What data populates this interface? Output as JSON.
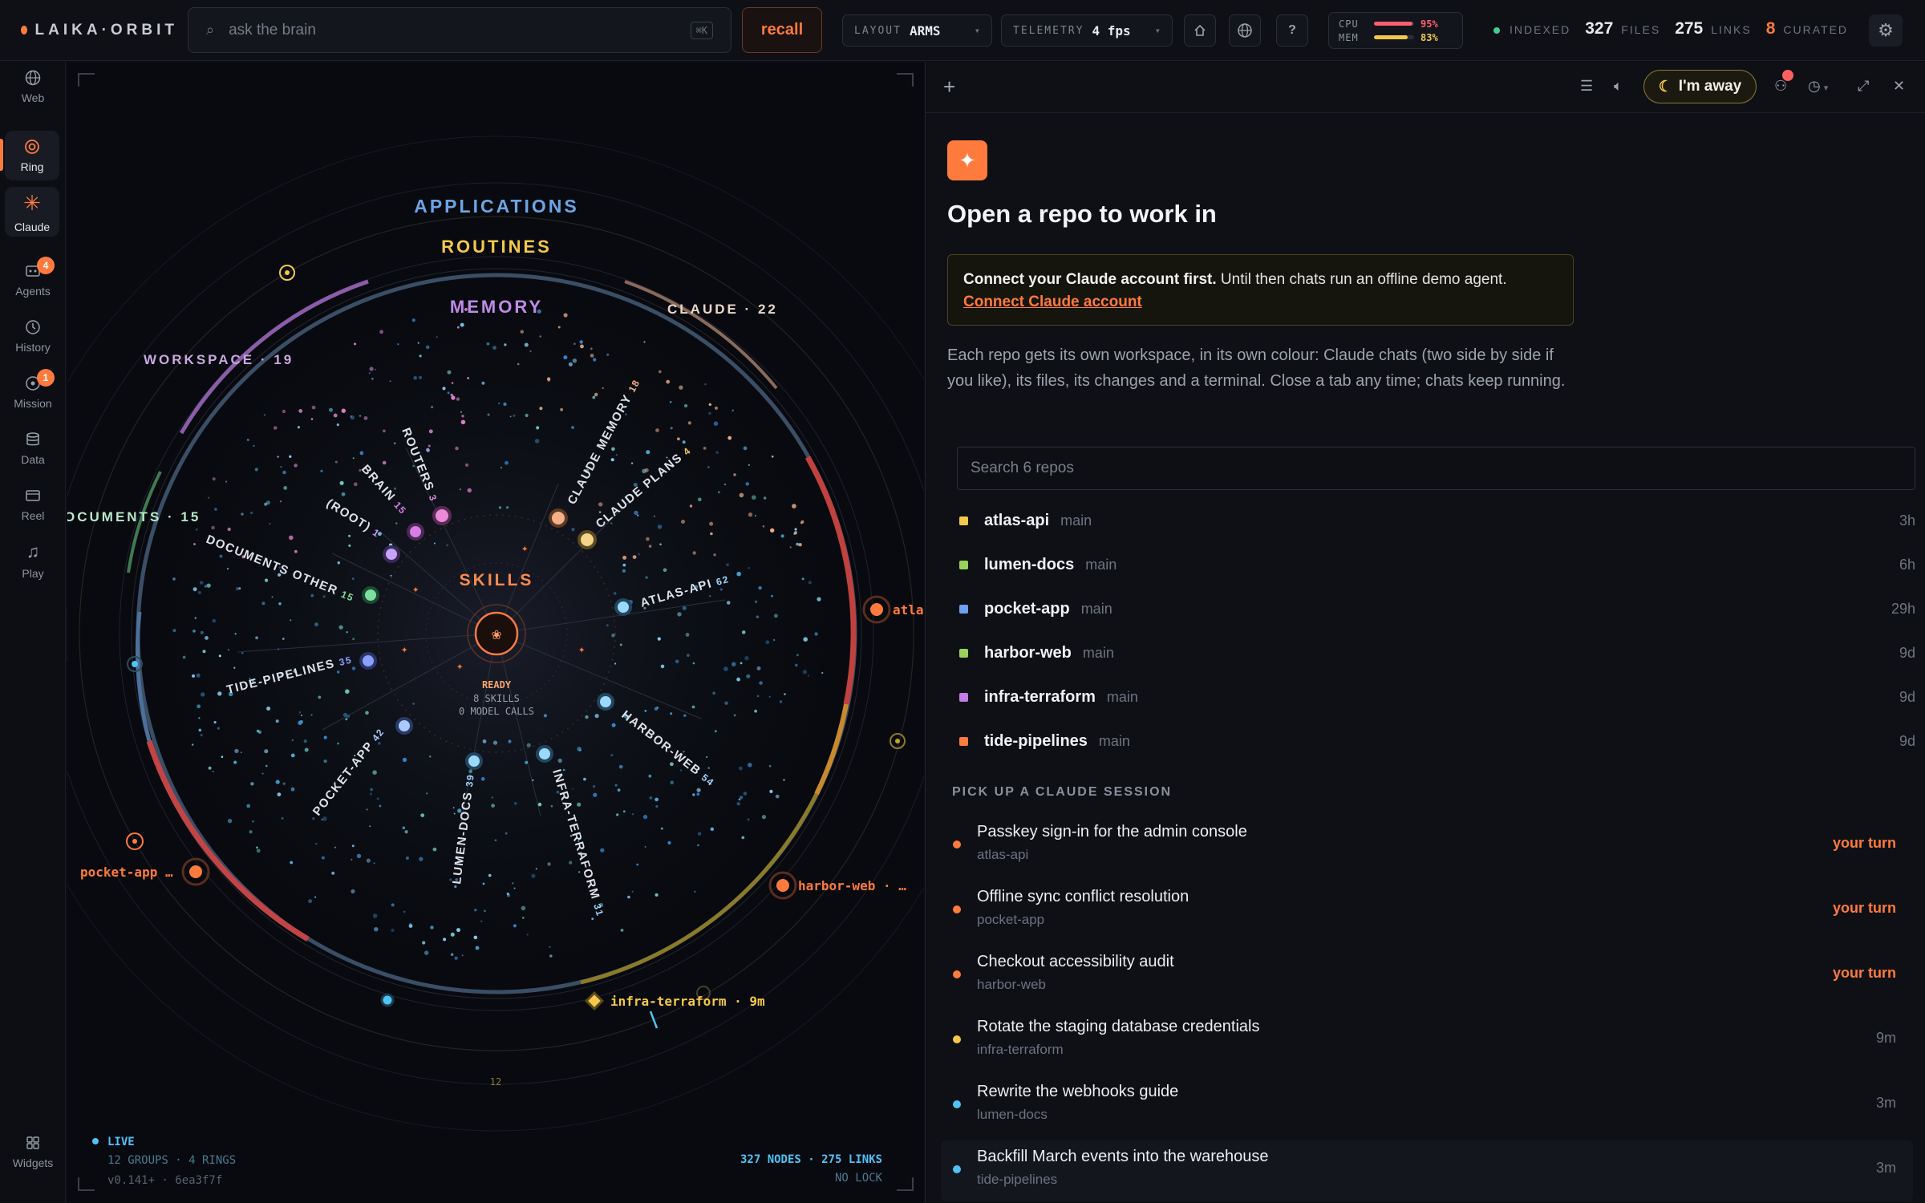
{
  "app": {
    "name": "LAIKA·ORBIT"
  },
  "search": {
    "placeholder": "ask the brain",
    "shortcut": "⌘K"
  },
  "recall_label": "recall",
  "layout": {
    "label": "LAYOUT",
    "value": "ARMS"
  },
  "telemetry": {
    "label": "TELEMETRY",
    "value": "4 fps"
  },
  "toolbar_icons": [
    "home-icon",
    "globe-icon",
    "help-icon"
  ],
  "help_glyph": "?",
  "resources": {
    "cpu_label": "CPU",
    "cpu_value": "95%",
    "cpu_fraction": 0.95,
    "mem_label": "MEM",
    "mem_value": "83%",
    "mem_fraction": 0.83
  },
  "index_stats": {
    "status": "INDEXED",
    "files": "327",
    "files_label": "FILES",
    "links": "275",
    "links_label": "LINKS",
    "curated": "8",
    "curated_label": "CURATED"
  },
  "rail": [
    {
      "label": "Web",
      "icon": "globe-icon"
    },
    {
      "label": "Ring",
      "icon": "ring-icon"
    },
    {
      "label": "Claude",
      "icon": "asterisk-icon"
    },
    {
      "label": "Agents",
      "icon": "agents-icon",
      "badge": "4"
    },
    {
      "label": "History",
      "icon": "history-icon"
    },
    {
      "label": "Mission",
      "icon": "mission-icon",
      "badge": "1"
    },
    {
      "label": "Data",
      "icon": "database-icon"
    },
    {
      "label": "Reel",
      "icon": "reel-icon"
    },
    {
      "label": "Play",
      "icon": "music-icon"
    },
    {
      "label": "Widgets",
      "icon": "grid-icon"
    }
  ],
  "ring": {
    "layers": [
      "APPLICATIONS",
      "ROUTINES",
      "MEMORY"
    ],
    "outer_labels": [
      "WORKSPACE · 19",
      "CLAUDE · 22",
      "OCUMENTS · 15"
    ],
    "core": {
      "title": "SKILLS",
      "status": "READY",
      "skills": "8 SKILLS",
      "calls": "0 MODEL CALLS"
    },
    "arms": [
      {
        "name": "ROUTERS",
        "count": "3"
      },
      {
        "name": "BRAIN",
        "count": "15"
      },
      {
        "name": "(ROOT)",
        "count": "1"
      },
      {
        "name": "DOCUMENTS OTHER",
        "count": "15"
      },
      {
        "name": "TIDE-PIPELINES",
        "count": "35"
      },
      {
        "name": "POCKET-APP",
        "count": "42"
      },
      {
        "name": "LUMEN-DOCS",
        "count": "39"
      },
      {
        "name": "INFRA-TERRAFORM",
        "count": "31"
      },
      {
        "name": "HARBOR-WEB",
        "count": "54"
      },
      {
        "name": "ATLAS-API",
        "count": "62"
      },
      {
        "name": "CLAUDE PLANS",
        "count": "4"
      },
      {
        "name": "CLAUDE MEMORY",
        "count": "18"
      }
    ],
    "satellites": [
      "atla",
      "pocket-app …",
      "harbor-web · …",
      "infra-terraform · 9m"
    ],
    "tick": "12",
    "footer": {
      "live": "LIVE",
      "groups": "12 GROUPS · 4 RINGS",
      "version": "v0.141+ · 6ea3f7f",
      "nodes": "327 NODES · 275 LINKS",
      "lock": "NO LOCK"
    }
  },
  "panel": {
    "away_label": "I'm away",
    "title": "Open a repo to work in",
    "notice_bold": "Connect your Claude account first.",
    "notice_rest": " Until then chats run an offline demo agent.",
    "notice_link": "Connect Claude account",
    "intro": "Each repo gets its own workspace, in its own colour: Claude chats (two side by side if you like), its files, its changes and a terminal. Close a tab any time; chats keep running.",
    "repo_search_placeholder": "Search 6 repos",
    "repos": [
      {
        "name": "atlas-api",
        "branch": "main",
        "age": "3h",
        "color": "#f5c84b"
      },
      {
        "name": "lumen-docs",
        "branch": "main",
        "age": "6h",
        "color": "#9bd35a"
      },
      {
        "name": "pocket-app",
        "branch": "main",
        "age": "29h",
        "color": "#6f9ff5"
      },
      {
        "name": "harbor-web",
        "branch": "main",
        "age": "9d",
        "color": "#9bd35a"
      },
      {
        "name": "infra-terraform",
        "branch": "main",
        "age": "9d",
        "color": "#c77be8"
      },
      {
        "name": "tide-pipelines",
        "branch": "main",
        "age": "9d",
        "color": "#ff7a3d"
      }
    ],
    "sessions_heading": "PICK UP A CLAUDE SESSION",
    "sessions": [
      {
        "title": "Passkey sign-in for the admin console",
        "repo": "atlas-api",
        "status": "your turn",
        "dot": "#ff7a3d"
      },
      {
        "title": "Offline sync conflict resolution",
        "repo": "pocket-app",
        "status": "your turn",
        "dot": "#ff7a3d"
      },
      {
        "title": "Checkout accessibility audit",
        "repo": "harbor-web",
        "status": "your turn",
        "dot": "#ff7a3d"
      },
      {
        "title": "Rotate the staging database credentials",
        "repo": "infra-terraform",
        "status": "9m",
        "dot": "#f5c84b"
      },
      {
        "title": "Rewrite the webhooks guide",
        "repo": "lumen-docs",
        "status": "3m",
        "dot": "#4fc3f7"
      },
      {
        "title": "Backfill March events into the warehouse",
        "repo": "tide-pipelines",
        "status": "3m",
        "dot": "#4fc3f7"
      }
    ]
  }
}
